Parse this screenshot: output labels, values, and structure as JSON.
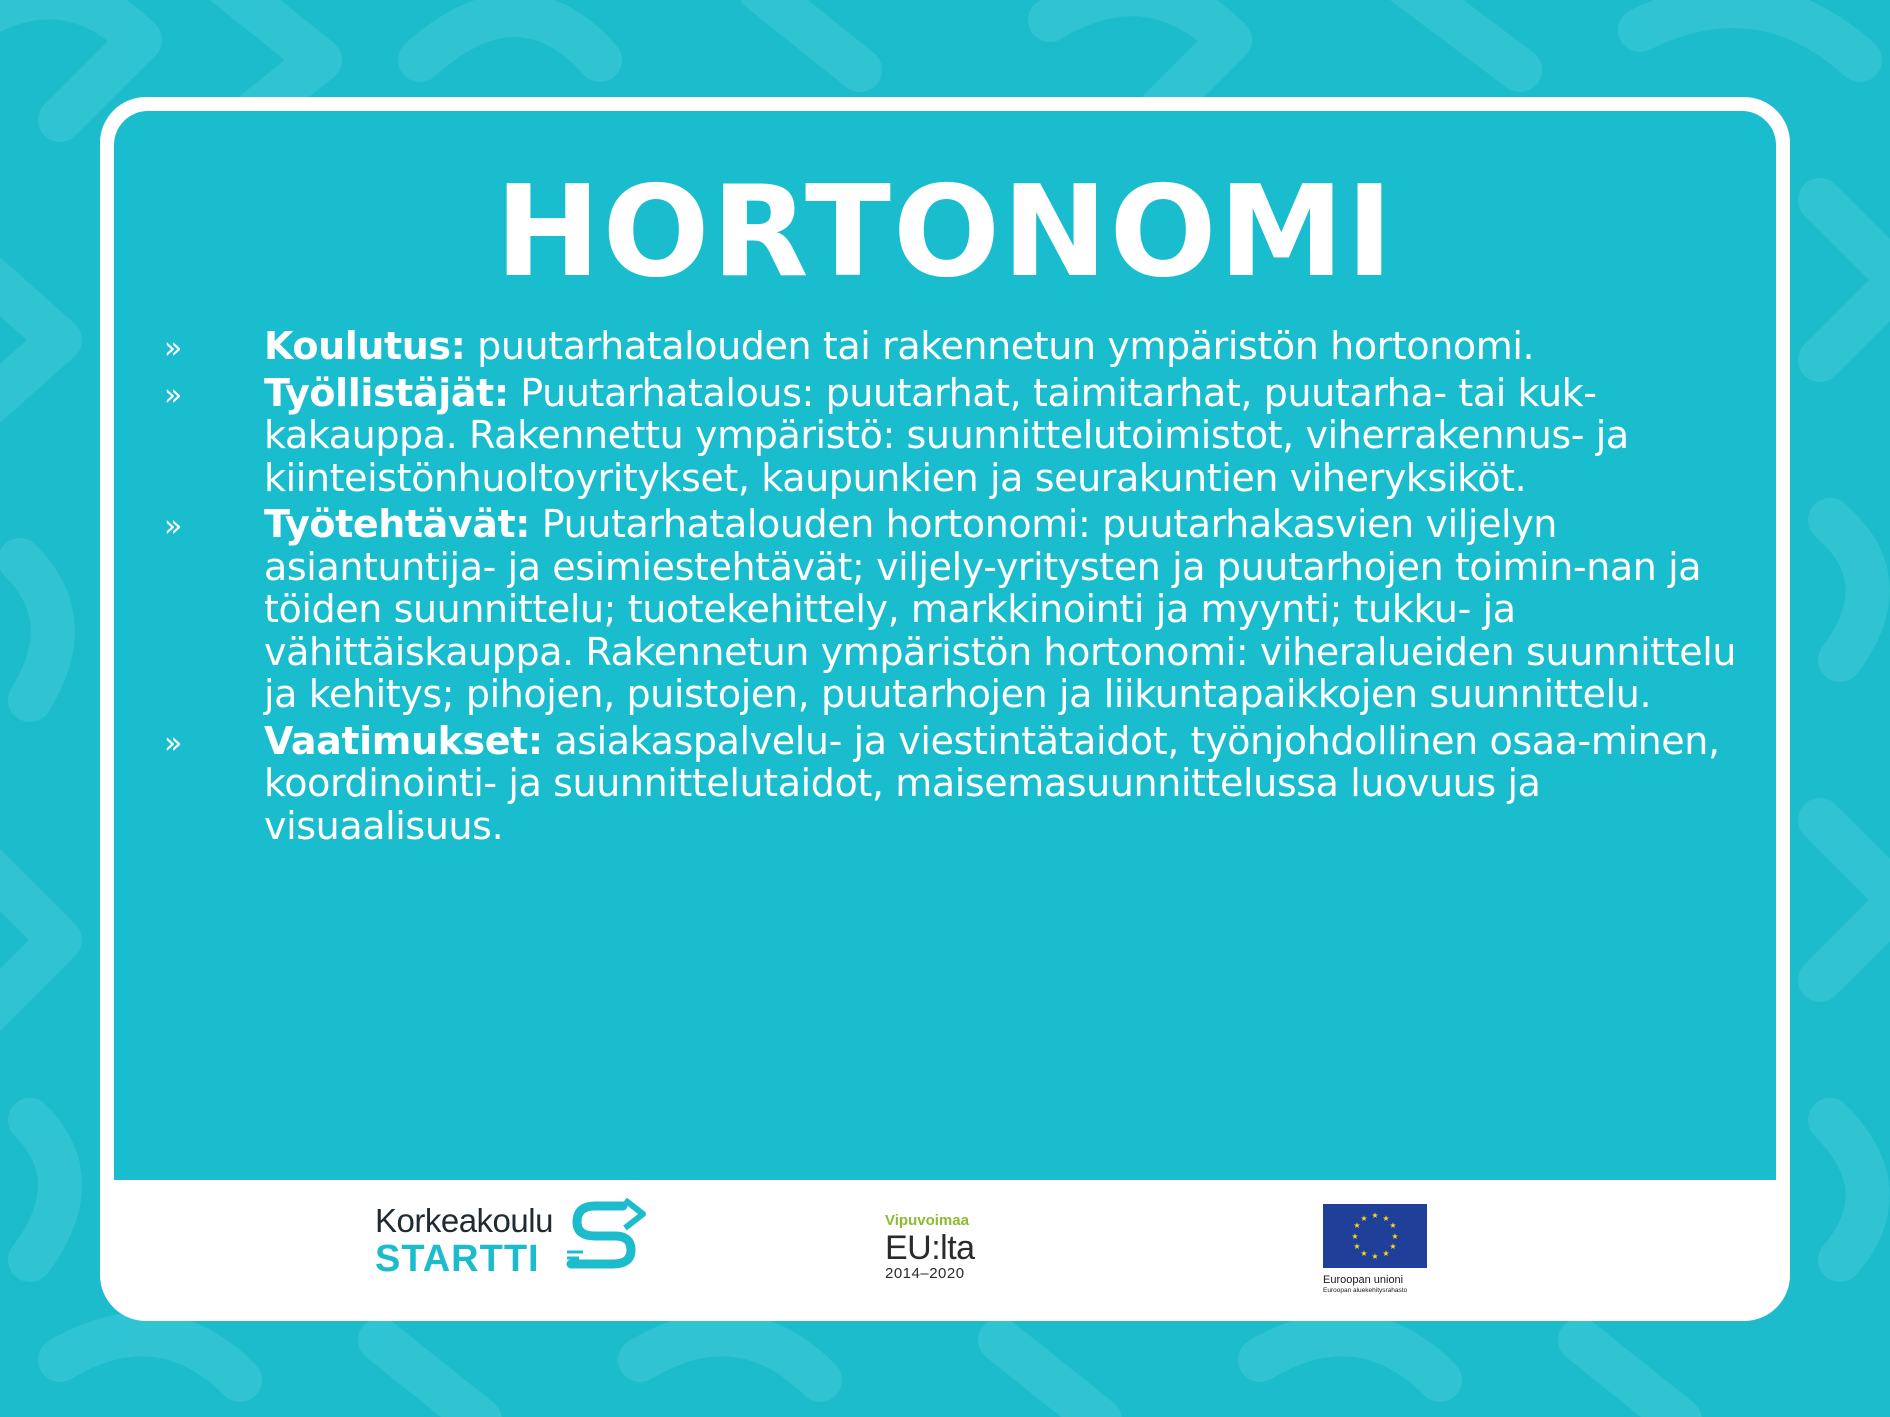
{
  "title": "HORTONOMI",
  "bullet_glyph": "»",
  "items": [
    {
      "label": "Koulutus:",
      "text": " puutarhatalouden tai rakennetun ympäristön hortonomi."
    },
    {
      "label": "Työllistäjät:",
      "text": " Puutarhatalous: puutarhat, taimitarhat, puutarha- tai kuk-kakauppa. Rakennettu ympäristö: suunnittelutoimistot, viherrakennus- ja kiinteistönhuoltoyritykset, kaupunkien ja seurakuntien viheryksiköt."
    },
    {
      "label": "Työtehtävät:",
      "text": " Puutarhatalouden hortonomi: puutarhakasvien viljelyn asiantuntija- ja esimiestehtävät; viljely-yritysten ja puutarhojen toimin-nan ja töiden suunnittelu; tuotekehittely, markkinointi ja myynti; tukku- ja vähittäiskauppa. Rakennetun ympäristön hortonomi: viheralueiden suunnittelu ja kehitys; pihojen, puistojen, puutarhojen ja liikuntapaikkojen suunnittelu."
    },
    {
      "label": "Vaatimukset:",
      "text": " asiakaspalvelu- ja viestintätaidot, työnjohdollinen osaa-minen, koordinointi- ja suunnittelutaidot, maisemasuunnittelussa luovuus ja visuaalisuus."
    }
  ],
  "footer": {
    "korkeakoulu_startti": {
      "line1": "Korkeakoulu",
      "line2": "STARTTI"
    },
    "vipuvoimaa": {
      "line1": "Vipuvoimaa",
      "line2": "EU:lta",
      "line3": "2014–2020"
    },
    "eu": {
      "line1": "Euroopan unioni",
      "line2": "Euroopan aluekehitysrahasto"
    }
  },
  "colors": {
    "background": "#1dbccd",
    "panel": "#19bdcd",
    "text": "#ffffff",
    "card": "#ffffff",
    "eu_blue": "#1f3f99",
    "eu_yellow": "#ffd617",
    "vipuvoimaa_green": "#8dbb2f"
  }
}
